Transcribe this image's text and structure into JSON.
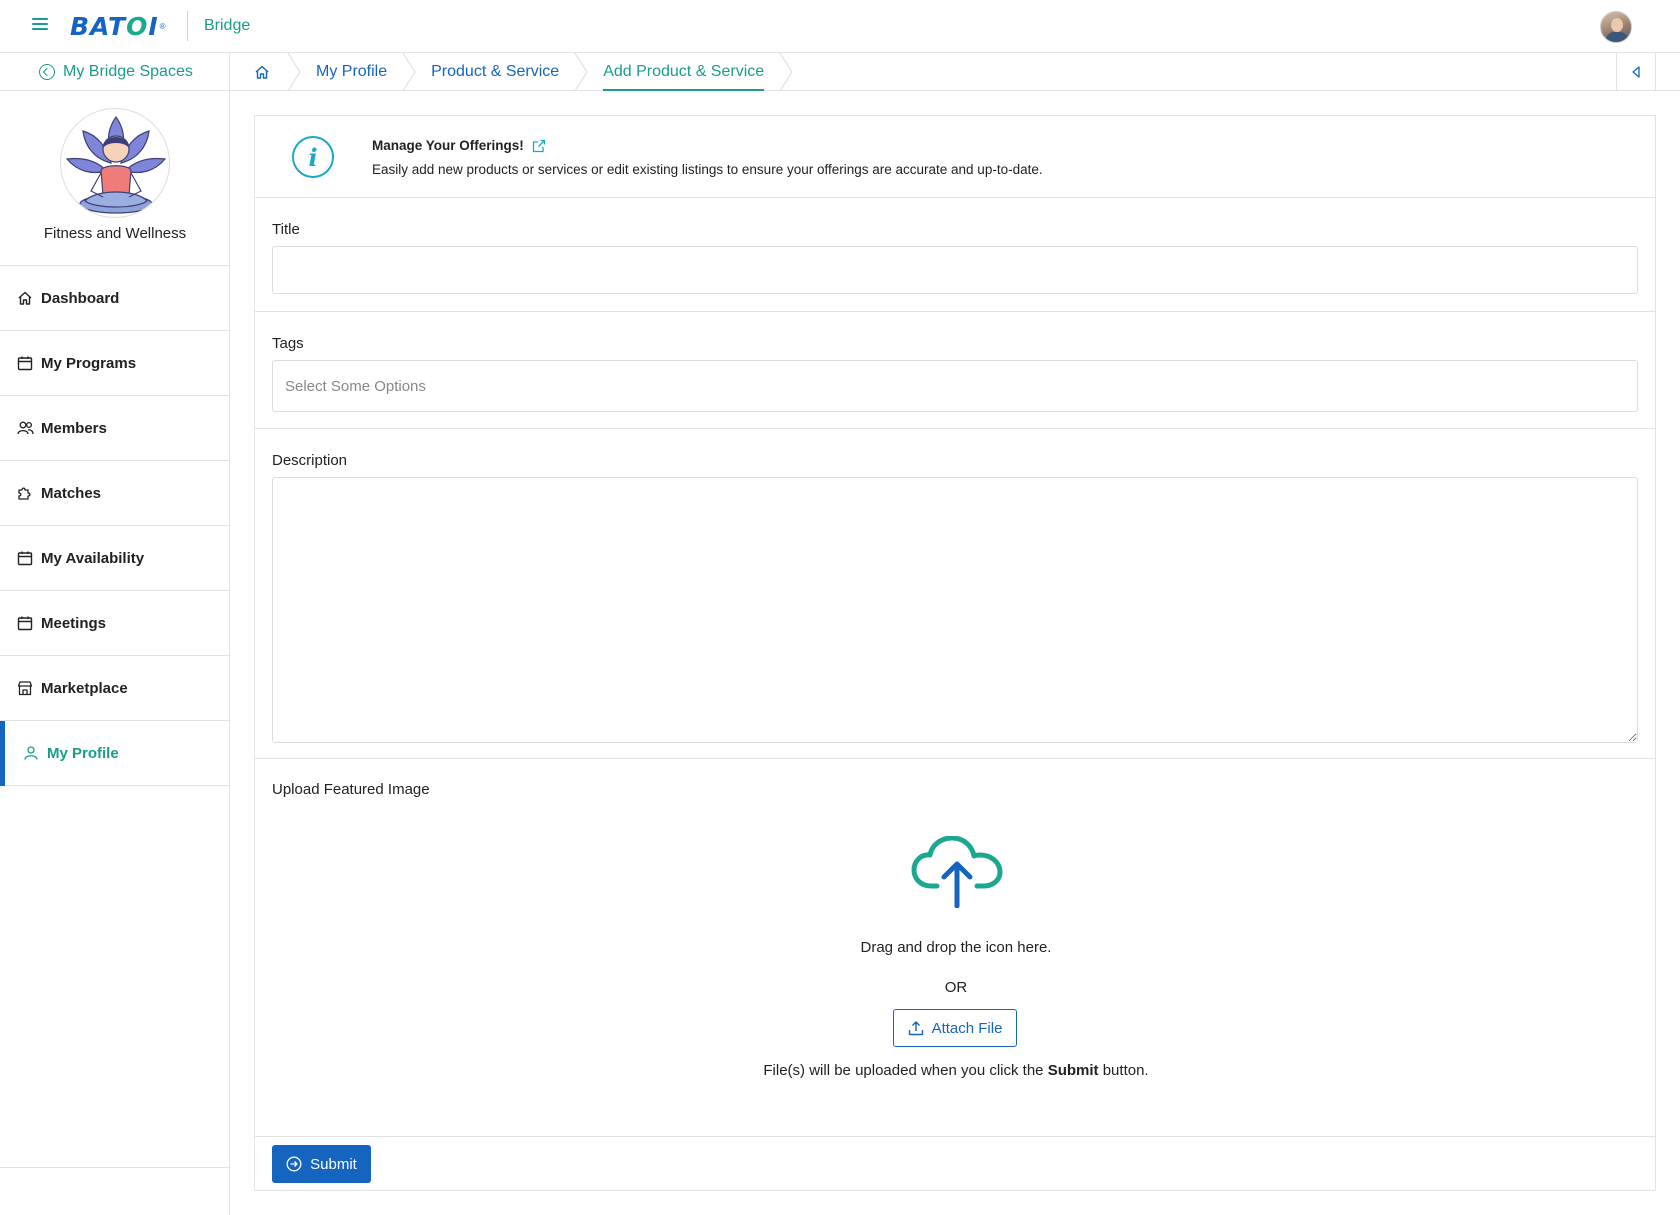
{
  "header": {
    "logo_text": "BATOI",
    "app_name": "Bridge"
  },
  "subnav": {
    "back_label": "My Bridge Spaces",
    "breadcrumbs": [
      {
        "label": "My Profile"
      },
      {
        "label": "Product & Service"
      },
      {
        "label": "Add Product & Service"
      }
    ]
  },
  "sidebar": {
    "space_name": "Fitness and Wellness",
    "items": [
      {
        "label": "Dashboard",
        "icon": "home-icon"
      },
      {
        "label": "My Programs",
        "icon": "calendar-icon"
      },
      {
        "label": "Members",
        "icon": "users-icon"
      },
      {
        "label": "Matches",
        "icon": "puzzle-icon"
      },
      {
        "label": "My Availability",
        "icon": "calendar-icon"
      },
      {
        "label": "Meetings",
        "icon": "calendar-icon"
      },
      {
        "label": "Marketplace",
        "icon": "store-icon"
      },
      {
        "label": "My Profile",
        "icon": "user-icon",
        "active": true
      }
    ]
  },
  "info": {
    "title": "Manage Your Offerings!",
    "description": "Easily add new products or services or edit existing listings to ensure your offerings are accurate and up-to-date."
  },
  "form": {
    "title_label": "Title",
    "title_value": "",
    "tags_label": "Tags",
    "tags_placeholder": "Select Some Options",
    "description_label": "Description",
    "description_value": "",
    "upload_label": "Upload Featured Image",
    "drag_text": "Drag and drop the icon here.",
    "or_text": "OR",
    "attach_label": "Attach File",
    "upload_note_before": "File(s) will be uploaded when you click the ",
    "upload_note_bold": "Submit",
    "upload_note_after": " button.",
    "submit_label": "Submit"
  },
  "colors": {
    "primary": "#1565c0",
    "accent": "#1a9c8c",
    "info": "#1aa8c8"
  }
}
